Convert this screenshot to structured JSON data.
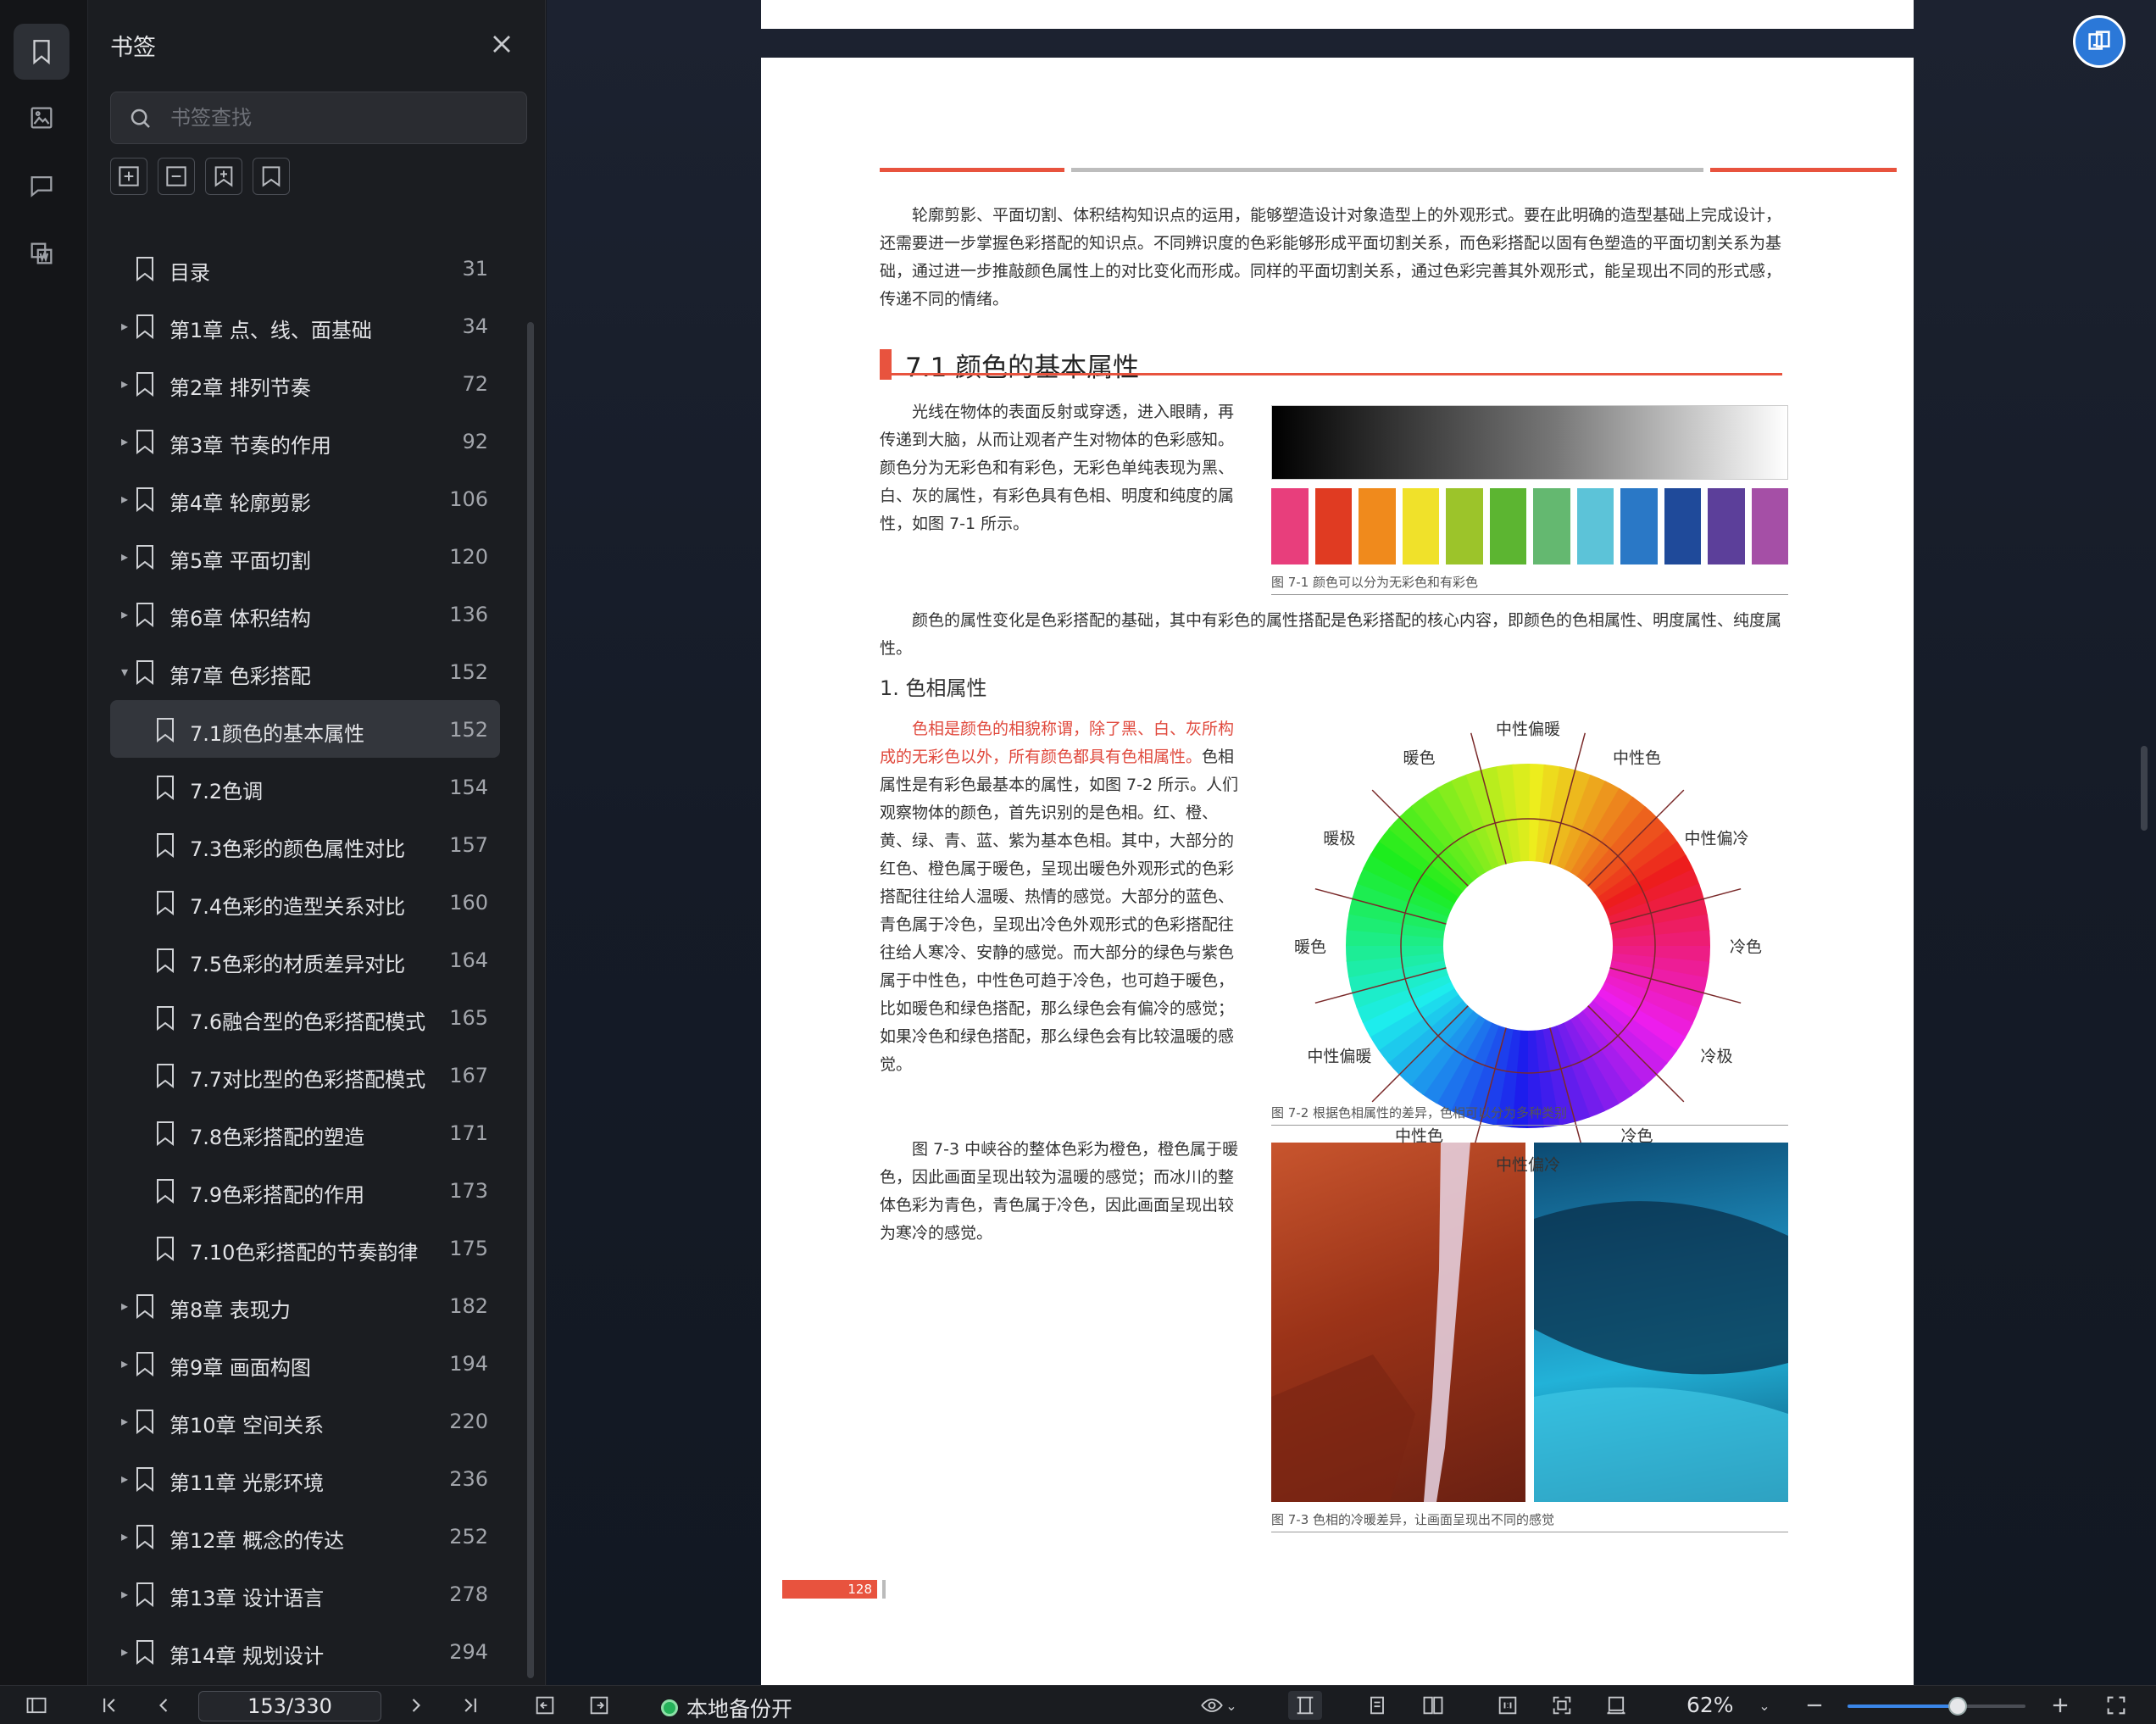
{
  "panel": {
    "title": "书签",
    "search_placeholder": "书签查找"
  },
  "bookmarks": [
    {
      "label": "目录",
      "page": "31",
      "level": 0,
      "caret": ""
    },
    {
      "label": "第1章 点、线、面基础",
      "page": "34",
      "level": 0,
      "caret": "▸"
    },
    {
      "label": "第2章 排列节奏",
      "page": "72",
      "level": 0,
      "caret": "▸"
    },
    {
      "label": "第3章 节奏的作用",
      "page": "92",
      "level": 0,
      "caret": "▸"
    },
    {
      "label": "第4章 轮廓剪影",
      "page": "106",
      "level": 0,
      "caret": "▸"
    },
    {
      "label": "第5章 平面切割",
      "page": "120",
      "level": 0,
      "caret": "▸"
    },
    {
      "label": "第6章 体积结构",
      "page": "136",
      "level": 0,
      "caret": "▸"
    },
    {
      "label": "第7章 色彩搭配",
      "page": "152",
      "level": 0,
      "caret": "▾"
    },
    {
      "label": "7.1颜色的基本属性",
      "page": "152",
      "level": 1,
      "caret": "",
      "selected": true
    },
    {
      "label": "7.2色调",
      "page": "154",
      "level": 1,
      "caret": ""
    },
    {
      "label": "7.3色彩的颜色属性对比",
      "page": "157",
      "level": 1,
      "caret": ""
    },
    {
      "label": "7.4色彩的造型关系对比",
      "page": "160",
      "level": 1,
      "caret": ""
    },
    {
      "label": "7.5色彩的材质差异对比",
      "page": "164",
      "level": 1,
      "caret": ""
    },
    {
      "label": "7.6融合型的色彩搭配模式",
      "page": "165",
      "level": 1,
      "caret": ""
    },
    {
      "label": "7.7对比型的色彩搭配模式",
      "page": "167",
      "level": 1,
      "caret": ""
    },
    {
      "label": "7.8色彩搭配的塑造",
      "page": "171",
      "level": 1,
      "caret": ""
    },
    {
      "label": "7.9色彩搭配的作用",
      "page": "173",
      "level": 1,
      "caret": ""
    },
    {
      "label": "7.10色彩搭配的节奏韵律",
      "page": "175",
      "level": 1,
      "caret": ""
    },
    {
      "label": "第8章 表现力",
      "page": "182",
      "level": 0,
      "caret": "▸"
    },
    {
      "label": "第9章 画面构图",
      "page": "194",
      "level": 0,
      "caret": "▸"
    },
    {
      "label": "第10章 空间关系",
      "page": "220",
      "level": 0,
      "caret": "▸"
    },
    {
      "label": "第11章 光影环境",
      "page": "236",
      "level": 0,
      "caret": "▸"
    },
    {
      "label": "第12章 概念的传达",
      "page": "252",
      "level": 0,
      "caret": "▸"
    },
    {
      "label": "第13章 设计语言",
      "page": "278",
      "level": 0,
      "caret": "▸"
    },
    {
      "label": "第14章 规划设计",
      "page": "294",
      "level": 0,
      "caret": "▸"
    }
  ],
  "doc": {
    "intro": "轮廓剪影、平面切割、体积结构知识点的运用，能够塑造设计对象造型上的外观形式。要在此明确的造型基础上完成设计，还需要进一步掌握色彩搭配的知识点。不同辨识度的色彩能够形成平面切割关系，而色彩搭配以固有色塑造的平面切割关系为基础，通过进一步推敲颜色属性上的对比变化而形成。同样的平面切割关系，通过色彩完善其外观形式，能呈现出不同的形式感，传递不同的情绪。",
    "section_title": "7.1 颜色的基本属性",
    "p1": "光线在物体的表面反射或穿透，进入眼睛，再传递到大脑，从而让观者产生对物体的色彩感知。颜色分为无彩色和有彩色，无彩色单纯表现为黑、白、灰的属性，有彩色具有色相、明度和纯度的属性，如图 7-1 所示。",
    "fig1_caption": "图 7-1  颜色可以分为无彩色和有彩色",
    "p2": "颜色的属性变化是色彩搭配的基础，其中有彩色的属性搭配是色彩搭配的核心内容，即颜色的色相属性、明度属性、纯度属性。",
    "sub1": "1. 色相属性",
    "p3_red": "色相是颜色的相貌称谓，除了黑、白、灰所构成的无彩色以外，所有颜色都具有色相属性。",
    "p3": "色相属性是有彩色最基本的属性，如图 7-2 所示。人们观察物体的颜色，首先识别的是色相。红、橙、黄、绿、青、蓝、紫为基本色相。其中，大部分的红色、橙色属于暖色，呈现出暖色外观形式的色彩搭配往往给人温暖、热情的感觉。大部分的蓝色、青色属于冷色，呈现出冷色外观形式的色彩搭配往往给人寒冷、安静的感觉。而大部分的绿色与紫色属于中性色，中性色可趋于冷色，也可趋于暖色，比如暖色和绿色搭配，那么绿色会有偏冷的感觉；如果冷色和绿色搭配，那么绿色会有比较温暖的感觉。",
    "fig2_caption": "图 7-2  根据色相属性的差异，色相可以分为多种类别",
    "wheel_labels": {
      "top": "中性偏暖",
      "tl": "暖色",
      "tr": "中性色",
      "l_up": "暖极",
      "r_up": "中性偏冷",
      "left": "暖色",
      "right": "冷色",
      "l_down": "中性偏暖",
      "r_down": "冷极",
      "bl": "中性色",
      "br": "冷色",
      "bottom": "中性偏冷"
    },
    "p4": "图 7-3 中峡谷的整体色彩为橙色，橙色属于暖色，因此画面呈现出较为温暖的感觉；而冰川的整体色彩为青色，青色属于冷色，因此画面呈现出较为寒冷的感觉。",
    "fig3_caption": "图 7-3  色相的冷暖差异，让画面呈现出不同的感觉",
    "page_number": "128",
    "swatch_colors": [
      "#e83e7c",
      "#e03b22",
      "#f08a1c",
      "#f0e12a",
      "#9cc42a",
      "#5cb531",
      "#64b870",
      "#5cc3d8",
      "#2a78c6",
      "#1f4a9a",
      "#5c3f9a",
      "#a54fa6"
    ]
  },
  "bottom": {
    "page_indicator": "153/330",
    "backup": "本地备份开",
    "zoom": "62%",
    "zoom_fraction": 0.62
  },
  "colors": {
    "accent": "#e8533e",
    "selection": "#33363c",
    "brand_blue": "#2b78d8",
    "backup_green": "#25b35a"
  }
}
